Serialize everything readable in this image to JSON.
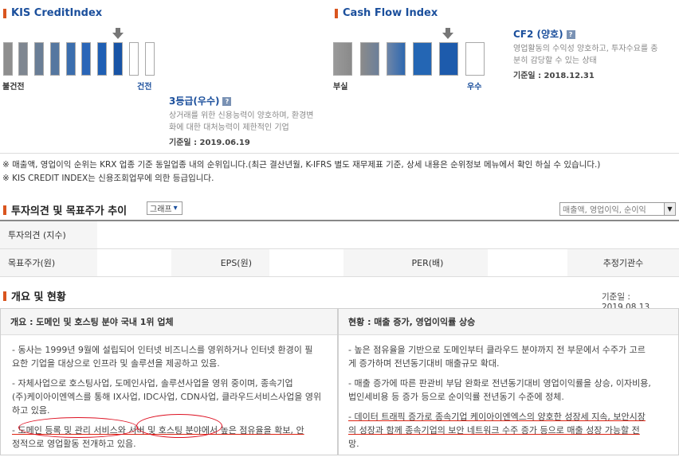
{
  "kis": {
    "title": "KIS CreditIndex",
    "left_label": "불건전",
    "right_label": "건전",
    "grade_title": "3등급(우수)",
    "desc_line1": "상거래를 위한 신용능력이 양호하며, 환경변",
    "desc_line2": "화에 대한 대처능력이 제한적인 기업",
    "date_label": "기준일 : 2019.06.19",
    "help_icon": "question-icon"
  },
  "cf": {
    "title": "Cash Flow Index",
    "left_label": "부실",
    "right_label": "우수",
    "grade_title": "CF2 (양호)",
    "desc_line1": "영업활동의 수익성 양호하고, 투자수요를 충",
    "desc_line2": "분히 감당할 수 있는 상태",
    "date_label": "기준일 : 2018.12.31",
    "help_icon": "question-icon"
  },
  "notes": {
    "line1": "※ 매출액, 영업이익 순위는 KRX 업종 기준 동일업종 내의 순위입니다.(최근 결산년월, K-IFRS 별도 재무제표 기준, 상세 내용은 순위정보 메뉴에서 확인 하실 수 있습니다.)",
    "line2": "※ KIS CREDIT INDEX는 신용조회업무에 의한 등급입니다."
  },
  "invest": {
    "title": "투자의견 및 목표주가 추이",
    "graph_select": "그래프",
    "sort_select": "매출액, 영업이익, 순이익",
    "row1_label": "투자의견 (지수)",
    "row2_label": "목표주가(원)",
    "eps_label": "EPS(원)",
    "per_label": "PER(배)",
    "analyst_label": "추정기관수"
  },
  "overview": {
    "title": "개요 및 현황",
    "date": "기준일 : 2019.08.13",
    "left_head": "개요 : 도메인 및 호스팅 분야 국내 1위 업체",
    "right_head": "현황 : 매출 증가, 영업이익률 상승",
    "left_b1_l1": "- 동사는 1999년 9월에 설립되어 인터넷 비즈니스를 영위하거나 인터넷 환경이 필",
    "left_b1_l2": "요한 기업을 대상으로 인프라 및 솔루션을 제공하고 있음.",
    "left_b2_l1": "- 자체사업으로 호스팅사업, 도메인사업, 솔루션사업을 영위 중이며, 종속기업",
    "left_b2_l2": "(주)케이아이엔엑스를 통해 IX사업, IDC사업, CDN사업, 클라우드서비스사업을 영위",
    "left_b2_l3": "하고 있음.",
    "left_b3_l1": "- 도메인 등록 및 관리 서비스와 서버 및 호스팅 분야에서 높은 점유율을 확보, 안",
    "left_b3_l2": "정적으로 영업활동 전개하고 있음.",
    "right_b1_l1": "- 높은 점유율을 기반으로 도메인부터 클라우드 분야까지 전 부문에서 수주가 고르",
    "right_b1_l2": "게 증가하며 전년동기대비 매출규모 확대.",
    "right_b2_l1": "- 매출 증가에 따른 판관비 부담 완화로 전년동기대비 영업이익률을 상승, 이자비용,",
    "right_b2_l2": "법인세비용 등 증가 등으로 순이익률 전년동기 수준에 정체.",
    "right_b3_l1": "- 데이터 트래픽 증가로 종속기업 케이아이엔엑스의 양호한 성장세 지속, 보안시장",
    "right_b3_l2": "의 성장과 함께 종속기업의 보안 네트워크 수주 증가 등으로 매출 성장 가능할 전",
    "right_b3_l3": "망."
  }
}
